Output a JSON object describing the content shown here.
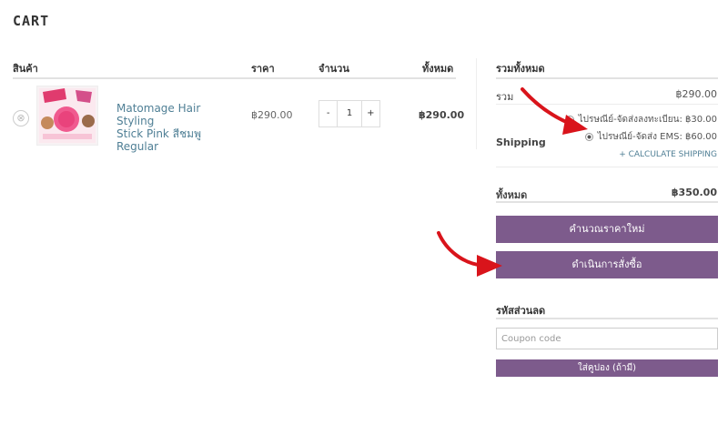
{
  "page": {
    "title": "CART"
  },
  "cart": {
    "headers": {
      "product": "สินค้า",
      "price": "ราคา",
      "quantity": "จำนวน",
      "total": "ทั้งหมด"
    },
    "item": {
      "remove_icon": "⊗",
      "name_line1": "Matomage Hair Styling",
      "name_line2": "Stick Pink สีชมพู Regular",
      "price": "฿290.00",
      "qty_minus": "-",
      "qty_value": "1",
      "qty_plus": "+",
      "line_total": "฿290.00"
    }
  },
  "totals": {
    "heading": "รวมทั้งหมด",
    "subtotal_label": "รวม",
    "subtotal_value": "฿290.00",
    "shipping_label": "Shipping",
    "shipping_options": [
      {
        "label": "ไปรษณีย์-จัดส่งลงทะเบียน: ฿30.00",
        "selected": false
      },
      {
        "label": "ไปรษณีย์-จัดส่ง EMS: ฿60.00",
        "selected": true
      }
    ],
    "calculate_shipping": "+ CALCULATE SHIPPING",
    "total_label": "ทั้งหมด",
    "total_value": "฿350.00",
    "recalculate_button": "คำนวณราคาใหม่",
    "checkout_button": "ดำเนินการสั่งซื้อ"
  },
  "coupon": {
    "heading": "รหัสส่วนลด",
    "placeholder": "Coupon code",
    "apply_button": "ใส่คูปอง (ถ้ามี)"
  },
  "colors": {
    "accent": "#7d5b8c",
    "link": "#4f7f95",
    "arrow": "#d9141b"
  }
}
